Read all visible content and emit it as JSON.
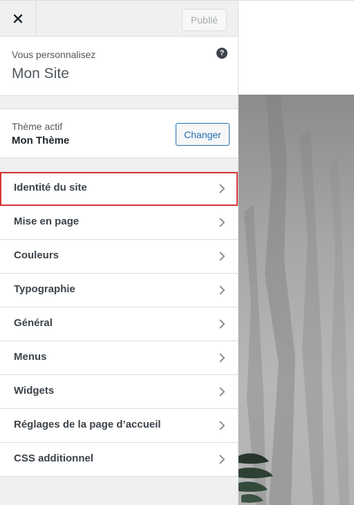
{
  "topbar": {
    "close_icon": "close-icon",
    "publish_label": "Publié"
  },
  "info": {
    "action": "Vous personnalisez",
    "site_title": "Mon Site",
    "help_icon": "help-icon",
    "help_glyph": "?"
  },
  "theme": {
    "label": "Thème actif",
    "name": "Mon Thème",
    "change_label": "Changer"
  },
  "menu": {
    "items": [
      {
        "label": "Identité du site",
        "highlighted": true
      },
      {
        "label": "Mise en page"
      },
      {
        "label": "Couleurs"
      },
      {
        "label": "Typographie"
      },
      {
        "label": "Général"
      },
      {
        "label": "Menus"
      },
      {
        "label": "Widgets"
      },
      {
        "label": "Réglages de la page d’accueil"
      },
      {
        "label": "CSS additionnel"
      }
    ]
  },
  "colors": {
    "accent": "#2271b1",
    "highlight_border": "#d63638"
  }
}
